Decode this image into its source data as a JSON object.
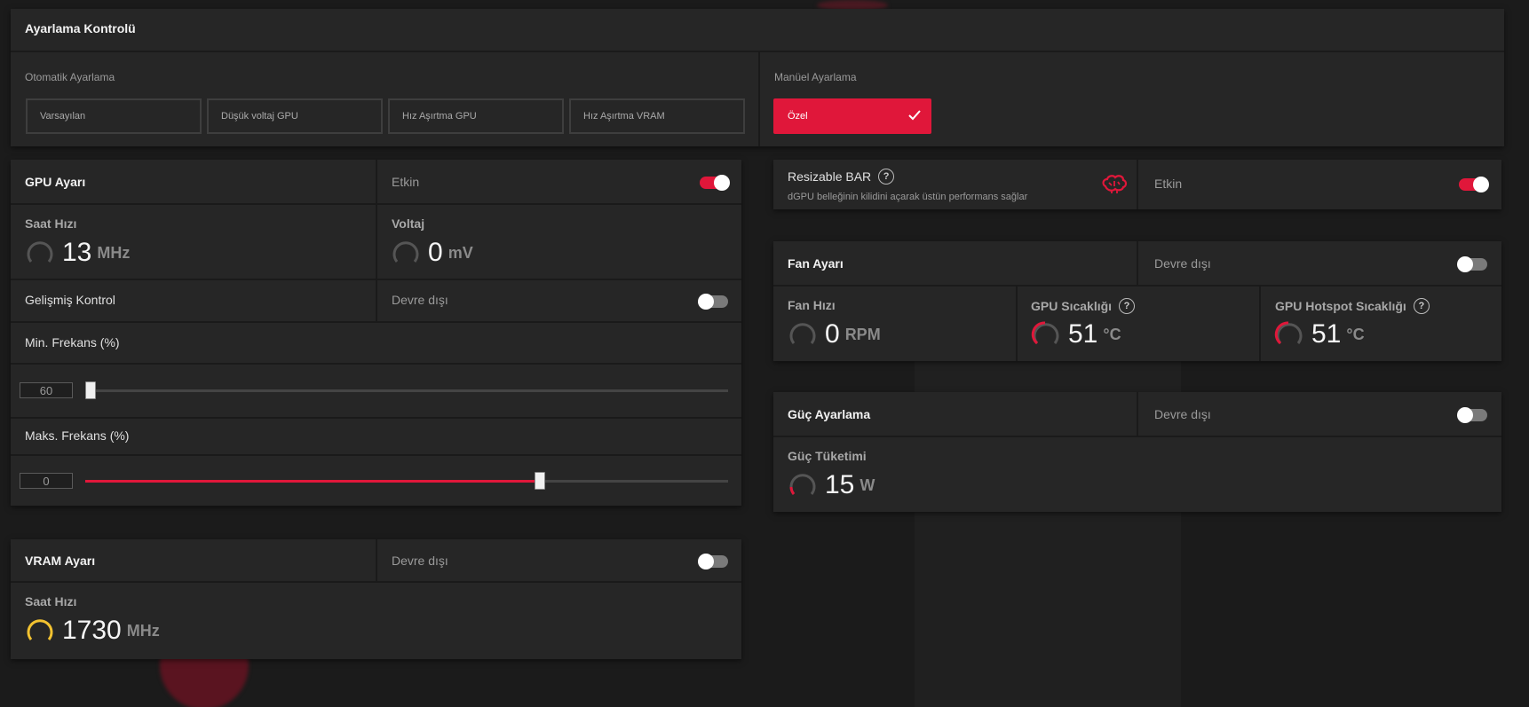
{
  "tuning_control": {
    "title": "Ayarlama Kontrolü",
    "auto_label": "Otomatik Ayarlama",
    "manual_label": "Manüel Ayarlama",
    "presets": [
      "Varsayılan",
      "Düşük voltaj GPU",
      "Hız Aşırtma GPU",
      "Hız Aşırtma VRAM"
    ],
    "custom_label": "Özel"
  },
  "gpu_tuning": {
    "title": "GPU Ayarı",
    "state": "Etkin",
    "enabled": true,
    "clock": {
      "label": "Saat Hızı",
      "value": "13",
      "unit": "MHz"
    },
    "voltage": {
      "label": "Voltaj",
      "value": "0",
      "unit": "mV"
    },
    "advanced": {
      "label": "Gelişmiş Kontrol",
      "state": "Devre dışı",
      "enabled": false
    },
    "min_freq": {
      "label": "Min. Frekans (%)",
      "value": "60",
      "slider_fraction": 0.0
    },
    "max_freq": {
      "label": "Maks. Frekans (%)",
      "value": "0",
      "slider_fraction": 0.71
    }
  },
  "vram_tuning": {
    "title": "VRAM Ayarı",
    "state": "Devre dışı",
    "enabled": false,
    "clock": {
      "label": "Saat Hızı",
      "value": "1730",
      "unit": "MHz"
    }
  },
  "resizable_bar": {
    "title": "Resizable BAR",
    "help": "?",
    "description": "dGPU belleğinin kilidini açarak üstün performans sağlar",
    "state": "Etkin",
    "enabled": true,
    "icon": "brain-icon"
  },
  "fan_tuning": {
    "title": "Fan Ayarı",
    "state": "Devre dışı",
    "enabled": false,
    "fan_speed": {
      "label": "Fan Hızı",
      "value": "0",
      "unit": "RPM"
    },
    "gpu_temp": {
      "label": "GPU Sıcaklığı",
      "value": "51",
      "unit": "°C"
    },
    "hotspot_temp": {
      "label": "GPU Hotspot Sıcaklığı",
      "value": "51",
      "unit": "°C"
    }
  },
  "power_tuning": {
    "title": "Güç Ayarlama",
    "state": "Devre dışı",
    "enabled": false,
    "consumption": {
      "label": "Güç Tüketimi",
      "value": "15",
      "unit": "W"
    }
  },
  "colors": {
    "accent": "#e0173a",
    "gauge_yellow": "#f2c230",
    "gauge_idle": "#555555"
  }
}
